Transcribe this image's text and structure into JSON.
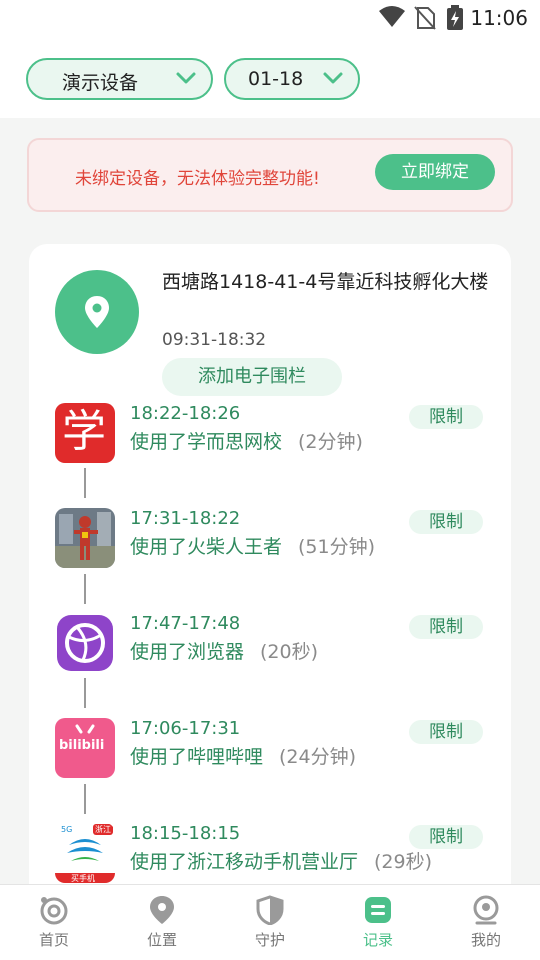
{
  "status": {
    "time": "11:06"
  },
  "selectors": {
    "device": "演示设备",
    "date": "01-18"
  },
  "banner": {
    "message": "未绑定设备，无法体验完整功能!",
    "button": "立即绑定"
  },
  "location": {
    "address": "西塘路1418-41-4号靠近科技孵化大楼",
    "time_range": "09:31-18:32",
    "fence_button": "添加电子围栏"
  },
  "records": [
    {
      "time": "18:22-18:26",
      "usage": "使用了学而思网校",
      "duration": "(2分钟)",
      "limit": "限制",
      "icon": "xueersi-app-icon"
    },
    {
      "time": "17:31-18:22",
      "usage": "使用了火柴人王者",
      "duration": "(51分钟)",
      "limit": "限制",
      "icon": "stickman-game-app-icon"
    },
    {
      "time": "17:47-17:48",
      "usage": "使用了浏览器",
      "duration": "(20秒)",
      "limit": "限制",
      "icon": "browser-app-icon"
    },
    {
      "time": "17:06-17:31",
      "usage": "使用了哔哩哔哩",
      "duration": "(24分钟)",
      "limit": "限制",
      "icon": "bilibili-app-icon"
    },
    {
      "time": "18:15-18:15",
      "usage": "使用了浙江移动手机营业厅",
      "duration": "(29秒)",
      "limit": "限制",
      "icon": "china-mobile-app-icon"
    }
  ],
  "icon_texts": {
    "xueersi": "学",
    "bilibili": "bilibili",
    "mobile_badge": "浙江",
    "mobile_5g": "5G",
    "mobile_bottom": "买手机"
  },
  "nav": [
    {
      "label": "首页",
      "icon": "home-camera-icon"
    },
    {
      "label": "位置",
      "icon": "location-icon"
    },
    {
      "label": "守护",
      "icon": "shield-icon"
    },
    {
      "label": "记录",
      "icon": "record-icon",
      "active": true
    },
    {
      "label": "我的",
      "icon": "profile-icon"
    }
  ],
  "colors": {
    "accent": "#4cc08a",
    "warning_text": "#e0453a",
    "green_text": "#2f8a5e"
  }
}
